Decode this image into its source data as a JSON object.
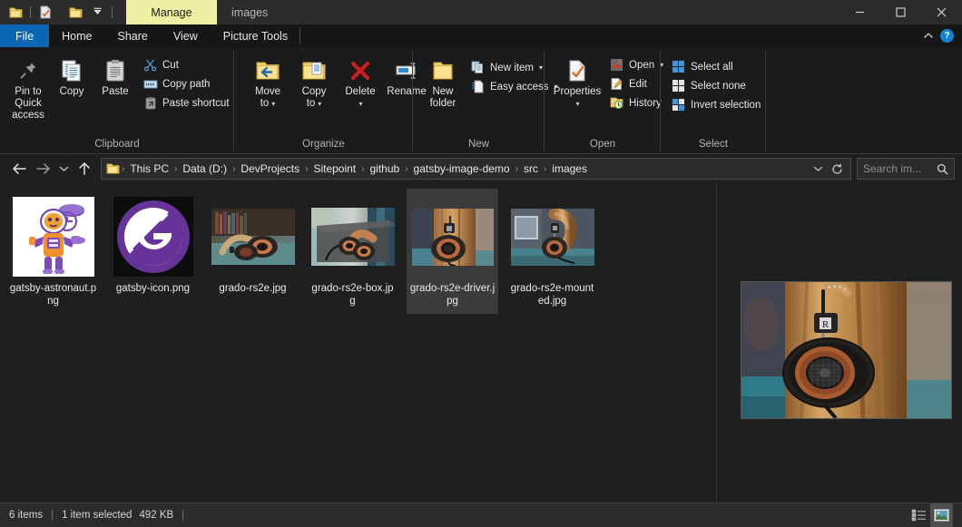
{
  "window": {
    "title": "images",
    "contextual_tab": "Manage",
    "quick_access": [
      {
        "name": "folder-icon",
        "label": "Folder"
      },
      {
        "name": "properties-icon",
        "label": "Properties"
      },
      {
        "name": "new-folder-icon",
        "label": "New folder"
      },
      {
        "name": "customize-qat-icon",
        "label": "Customize Quick Access Toolbar"
      }
    ],
    "controls": {
      "minimize": "—",
      "maximize": "□",
      "close": "✕"
    }
  },
  "tabs": [
    {
      "id": "file",
      "label": "File"
    },
    {
      "id": "home",
      "label": "Home"
    },
    {
      "id": "share",
      "label": "Share"
    },
    {
      "id": "view",
      "label": "View"
    },
    {
      "id": "picture-tools",
      "label": "Picture Tools"
    }
  ],
  "tabstrip_right": {
    "collapse_ribbon": "ⱏ",
    "help": "?"
  },
  "ribbon": {
    "groups": [
      {
        "id": "clipboard",
        "label": "Clipboard",
        "big_buttons": [
          {
            "id": "pin-to-quick-access",
            "line1": "Pin to Quick",
            "line2": "access",
            "icon": "pin-icon"
          },
          {
            "id": "copy",
            "line1": "Copy",
            "line2": "",
            "icon": "copy-icon"
          },
          {
            "id": "paste",
            "line1": "Paste",
            "line2": "",
            "icon": "paste-icon"
          }
        ],
        "small_buttons": [
          {
            "id": "cut",
            "label": "Cut",
            "icon": "scissors-icon"
          },
          {
            "id": "copy-path",
            "label": "Copy path",
            "icon": "copy-path-icon"
          },
          {
            "id": "paste-shortcut",
            "label": "Paste shortcut",
            "icon": "paste-shortcut-icon"
          }
        ]
      },
      {
        "id": "organize",
        "label": "Organize",
        "big_buttons": [
          {
            "id": "move-to",
            "line1": "Move",
            "line2": "to",
            "icon": "move-to-icon",
            "caret": true
          },
          {
            "id": "copy-to",
            "line1": "Copy",
            "line2": "to",
            "icon": "copy-to-icon",
            "caret": true
          },
          {
            "id": "delete",
            "line1": "Delete",
            "line2": "",
            "icon": "delete-icon",
            "caret_below": true
          },
          {
            "id": "rename",
            "line1": "Rename",
            "line2": "",
            "icon": "rename-icon"
          }
        ],
        "small_buttons": []
      },
      {
        "id": "new",
        "label": "New",
        "big_buttons": [
          {
            "id": "new-folder",
            "line1": "New",
            "line2": "folder",
            "icon": "new-folder-icon"
          }
        ],
        "small_buttons": [
          {
            "id": "new-item",
            "label": "New item",
            "icon": "new-item-icon",
            "caret": true
          },
          {
            "id": "easy-access",
            "label": "Easy access",
            "icon": "easy-access-icon",
            "caret": true
          }
        ]
      },
      {
        "id": "open",
        "label": "Open",
        "big_buttons": [
          {
            "id": "properties",
            "line1": "Properties",
            "line2": "",
            "icon": "properties-icon",
            "caret_below": true
          }
        ],
        "small_buttons": [
          {
            "id": "open",
            "label": "Open",
            "icon": "open-icon",
            "caret": true
          },
          {
            "id": "edit",
            "label": "Edit",
            "icon": "edit-icon"
          },
          {
            "id": "history",
            "label": "History",
            "icon": "history-icon"
          }
        ]
      },
      {
        "id": "select",
        "label": "Select",
        "big_buttons": [],
        "small_buttons": [
          {
            "id": "select-all",
            "label": "Select all",
            "icon": "select-all-icon"
          },
          {
            "id": "select-none",
            "label": "Select none",
            "icon": "select-none-icon"
          },
          {
            "id": "invert-selection",
            "label": "Invert selection",
            "icon": "invert-selection-icon"
          }
        ]
      }
    ]
  },
  "address_bar": {
    "back": "←",
    "forward": "→",
    "recent": "ⱟ",
    "up": "↑",
    "breadcrumbs": [
      "This PC",
      "Data (D:)",
      "DevProjects",
      "Sitepoint",
      "github",
      "gatsby-image-demo",
      "src",
      "images"
    ],
    "separator": "›",
    "dropdown": "ⱟ",
    "refresh": "↻",
    "search_placeholder": "Search im..."
  },
  "files": [
    {
      "id": "gatsby-astronaut",
      "name": "gatsby-astronaut.png",
      "type": "png",
      "thumb": "astronaut",
      "selected": false
    },
    {
      "id": "gatsby-icon",
      "name": "gatsby-icon.png",
      "type": "png",
      "thumb": "gatsby-logo",
      "selected": false
    },
    {
      "id": "grado-rs2e",
      "name": "grado-rs2e.jpg",
      "type": "jpg",
      "thumb": "headphones-flat",
      "selected": false
    },
    {
      "id": "grado-rs2e-box",
      "name": "grado-rs2e-box.jpg",
      "type": "jpg",
      "thumb": "headphones-box",
      "selected": false
    },
    {
      "id": "grado-rs2e-driver",
      "name": "grado-rs2e-driver.jpg",
      "type": "jpg",
      "thumb": "headphones-driver",
      "selected": true
    },
    {
      "id": "grado-rs2e-mounted",
      "name": "grado-rs2e-mounted.jpg",
      "type": "jpg",
      "thumb": "headphones-mounted",
      "selected": false
    }
  ],
  "preview": {
    "file": "grado-rs2e-driver.jpg",
    "alt": "Grado RS2e headphone driver on wooden stand"
  },
  "status_bar": {
    "item_count": "6 items",
    "selection": "1 item selected",
    "size": "492 KB",
    "separator": "|",
    "views": [
      {
        "id": "details-view",
        "label": "Details view",
        "active": false
      },
      {
        "id": "large-icons-view",
        "label": "Large icons view",
        "active": true
      }
    ]
  },
  "colors": {
    "accent_blue": "#0b67b3",
    "contextual_yellow": "#eff0a4",
    "window_bg": "#1f1f1f",
    "ribbon_bg": "#1b1b1b",
    "titlebar_bg": "#2b2b2b",
    "selection_bg": "#3b3b3b",
    "gatsby_purple": "#663399",
    "delete_red": "#cc1e1e"
  }
}
